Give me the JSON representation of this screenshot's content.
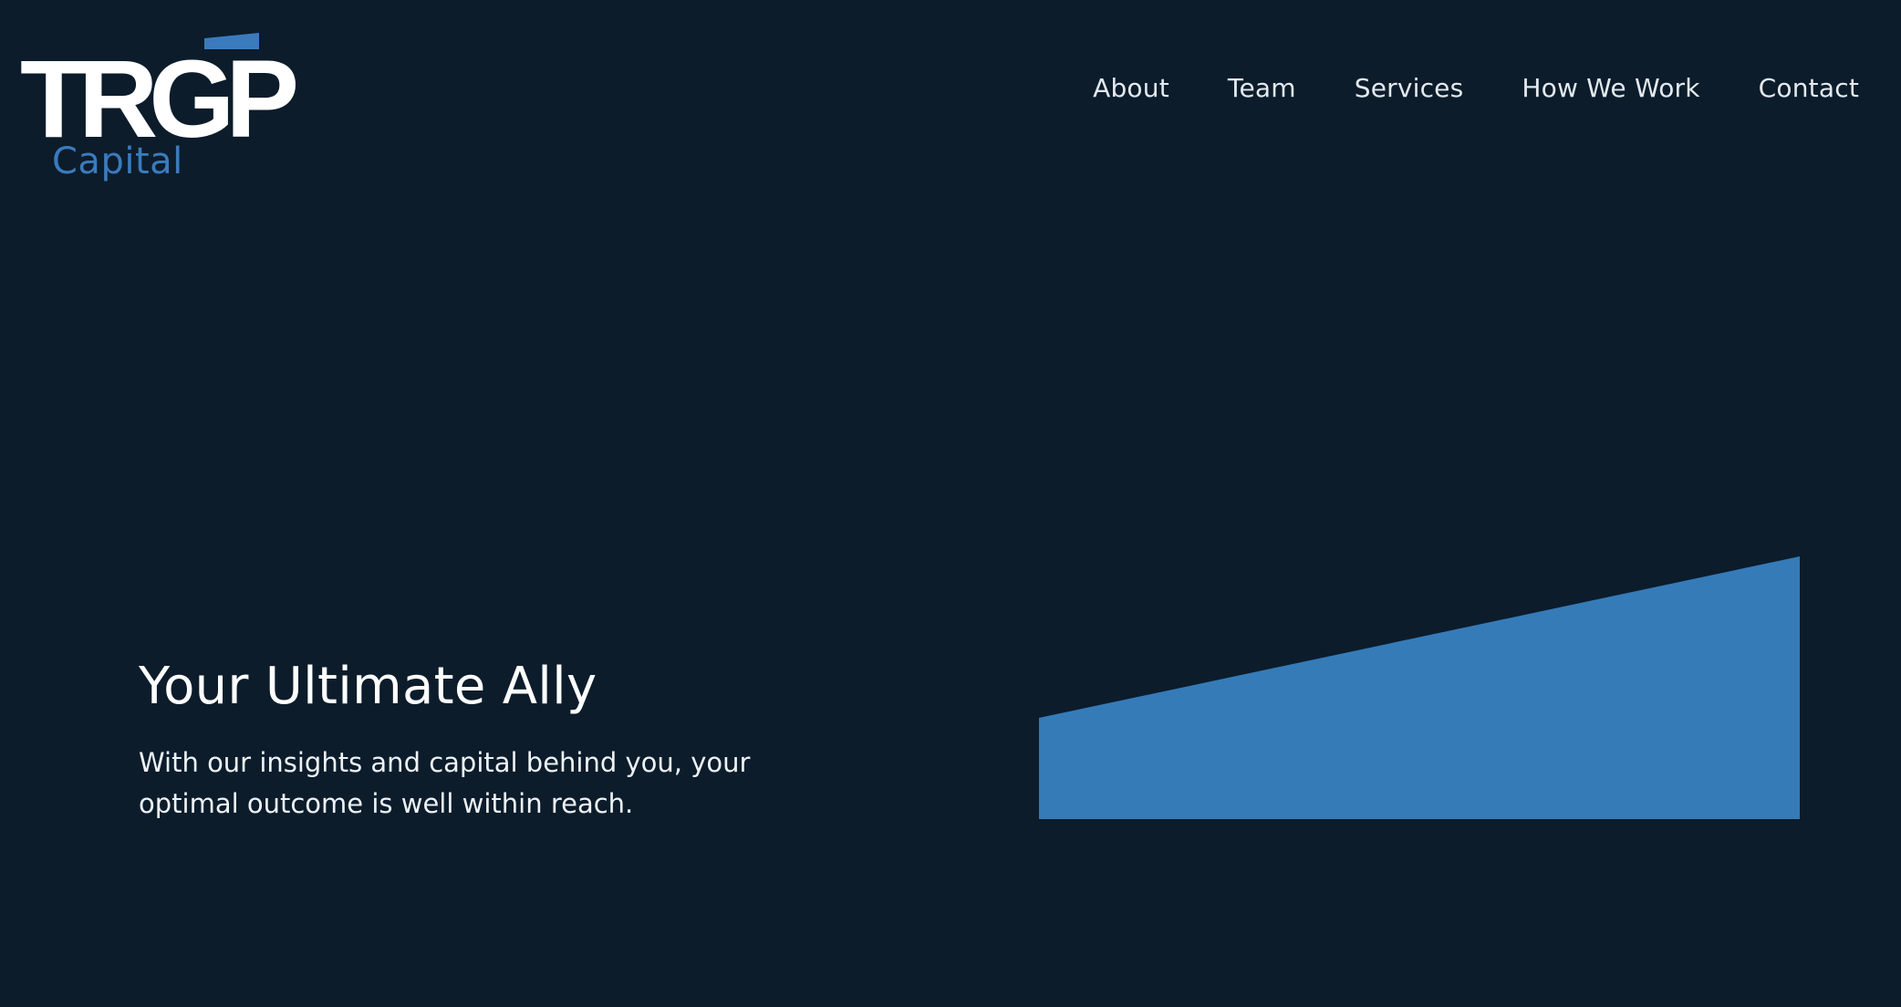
{
  "brand": {
    "wordmark": "TRGP",
    "sub_label": "Capital",
    "accent_color": "#3a7bbd",
    "background_color": "#0c1c2b"
  },
  "nav": {
    "items": [
      {
        "label": "About"
      },
      {
        "label": "Team"
      },
      {
        "label": "Services"
      },
      {
        "label": "How We Work"
      },
      {
        "label": "Contact"
      }
    ]
  },
  "hero": {
    "title": "Your Ultimate Ally",
    "description": "With our insights and capital behind you, your optimal outcome is well within reach."
  }
}
